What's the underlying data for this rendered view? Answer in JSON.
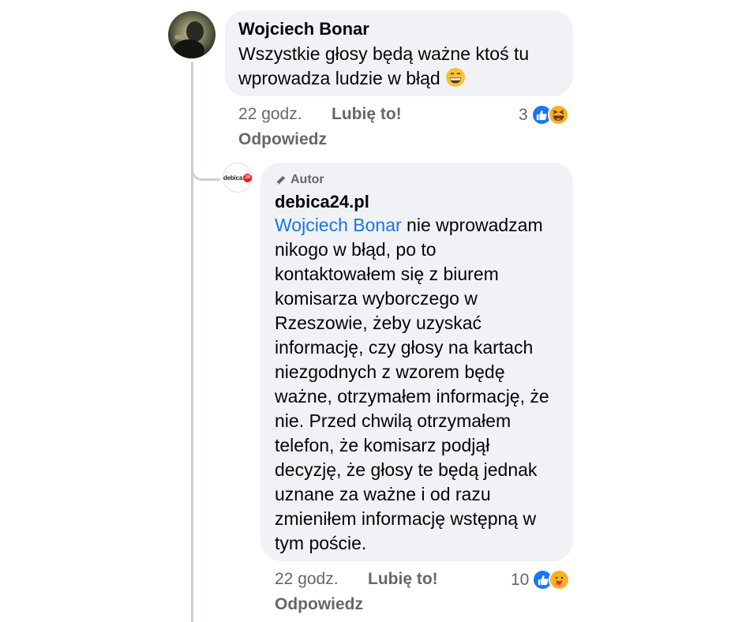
{
  "comment": {
    "author": "Wojciech Bonar",
    "text": "Wszystkie głosy będą ważne ktoś tu wprowadza ludzie w błąd",
    "time": "22 godz.",
    "like_label": "Lubię to!",
    "reaction_count": "3",
    "reactions": [
      "like-icon",
      "laughing-icon"
    ],
    "reply_label": "Odpowiedz"
  },
  "reply": {
    "badge": "Autor",
    "author": "debica24.pl",
    "avatar_logo": "debica24",
    "mention": "Wojciech Bonar",
    "text": " nie wprowadzam nikogo w błąd, po to kontaktowałem się z biurem komisarza wyborczego w Rzeszowie, żeby uzyskać informację, czy głosy na kartach niezgodnych z wzorem będę ważne, otrzymałem informację, że nie. Przed chwilą otrzymałem telefon, że komisarz podjął decyzję, że głosy te będą jednak uznane za ważne i od razu zmieniłem informację wstępną w tym poście.",
    "time": "22 godz.",
    "like_label": "Lubię to!",
    "reaction_count": "10",
    "reactions": [
      "like-icon",
      "care-icon"
    ],
    "reply_label": "Odpowiedz"
  },
  "colors": {
    "bubble": "#f0f2f5",
    "mention": "#1b74e4",
    "meta_text": "#65676b",
    "like_blue": "#1877f2",
    "thread_line": "#ccd0d5"
  }
}
